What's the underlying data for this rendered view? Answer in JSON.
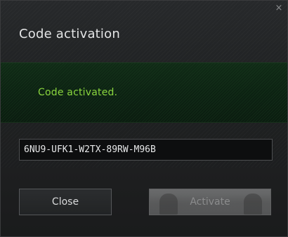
{
  "dialog": {
    "title": "Code activation",
    "close_glyph": "×",
    "close_icon": "close-icon"
  },
  "banner": {
    "message": "Code activated.",
    "color": "#8ad63e"
  },
  "code_input": {
    "value": "6NU9-UFK1-W2TX-89RW-M96B"
  },
  "buttons": {
    "close_label": "Close",
    "activate_label": "Activate"
  }
}
